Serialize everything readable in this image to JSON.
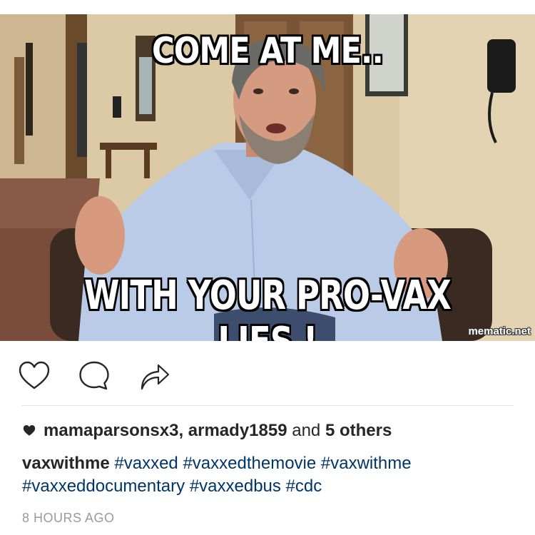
{
  "post": {
    "meme": {
      "top_text": "COME AT ME..",
      "bottom_text": "WITH YOUR PRO-VAX LIES !",
      "watermark": "mematic.net"
    },
    "actions": {
      "like_icon": "heart-outline-icon",
      "comment_icon": "speech-bubble-icon",
      "share_icon": "share-arrow-icon"
    },
    "likes": {
      "icon": "heart-filled-icon",
      "user1": "mamaparsonsx3",
      "separator": ", ",
      "user2": "armady1859",
      "and": " and ",
      "others": "5 others"
    },
    "caption": {
      "username": "vaxwithme",
      "hashtags": [
        "#vaxxed",
        "#vaxxedthemovie",
        "#vaxwithme",
        "#vaxxeddocumentary",
        "#vaxxedbus",
        "#cdc"
      ]
    },
    "timestamp": "8 HOURS AGO"
  },
  "colors": {
    "text": "#262626",
    "hashtag": "#003569",
    "timestamp": "#999999",
    "divider": "#e3e3e3"
  }
}
